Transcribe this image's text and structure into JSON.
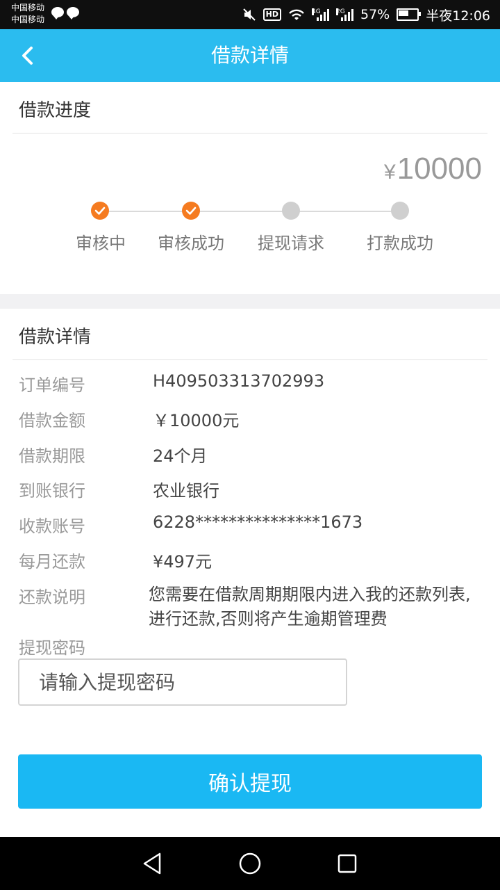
{
  "status_bar": {
    "carrier_1": "中国移动",
    "carrier_2": "中国移动",
    "hd": "HD",
    "net_1": "4G",
    "net_2": "2G",
    "battery_pct": "57%",
    "time": "半夜12:06"
  },
  "header": {
    "title": "借款详情",
    "back_icon": "chevron-left-icon"
  },
  "progress": {
    "title": "借款进度",
    "currency": "¥",
    "amount": "10000",
    "steps": [
      {
        "label": "审核中",
        "done": true
      },
      {
        "label": "审核成功",
        "done": true
      },
      {
        "label": "提现请求",
        "done": false
      },
      {
        "label": "打款成功",
        "done": false
      }
    ]
  },
  "details": {
    "title": "借款详情",
    "rows": [
      {
        "label": "订单编号",
        "value": "H409503313702993"
      },
      {
        "label": "借款金额",
        "value": "￥10000元"
      },
      {
        "label": "借款期限",
        "value": "24个月"
      },
      {
        "label": "到账银行",
        "value": "农业银行"
      },
      {
        "label": "收款账号",
        "value": "6228***************1673"
      },
      {
        "label": "每月还款",
        "value": "¥497元"
      }
    ],
    "note_label": "还款说明",
    "note_value": "您需要在借款周期期限内进入我的还款列表,进行还款,否则将产生逾期管理费",
    "password_label": "提现密码",
    "password_placeholder": "请输入提现密码",
    "password_value": ""
  },
  "confirm_button": "确认提现",
  "colors": {
    "header_bg": "#2bbcef",
    "step_done": "#f57b20",
    "step_todo": "#cfcfcf",
    "button_bg": "#1ab8f3"
  }
}
